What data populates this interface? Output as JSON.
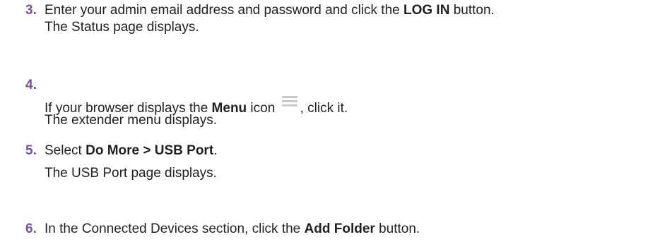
{
  "steps": [
    {
      "number": "3.",
      "instruction_pre": "Enter your admin email address and password and click the ",
      "instruction_bold": "LOG IN",
      "instruction_post": " button.",
      "result": "The Status page displays."
    },
    {
      "number": "4.",
      "instruction_pre": "If your browser displays the ",
      "instruction_bold": "Menu",
      "instruction_mid": " icon ",
      "instruction_post": ", click it.",
      "result": "The extender menu displays.",
      "icon": "menu-icon"
    },
    {
      "number": "5.",
      "instruction_pre": "Select ",
      "instruction_bold": "Do More > USB Port",
      "instruction_post": ".",
      "result": "The USB Port page displays."
    },
    {
      "number": "6.",
      "instruction_pre": "In the Connected Devices section, click the ",
      "instruction_bold": "Add Folder",
      "instruction_post": " button."
    }
  ],
  "colors": {
    "step_number": "#7b4fa0",
    "text": "#231f20",
    "icon_bars": "#c9c9c9"
  }
}
